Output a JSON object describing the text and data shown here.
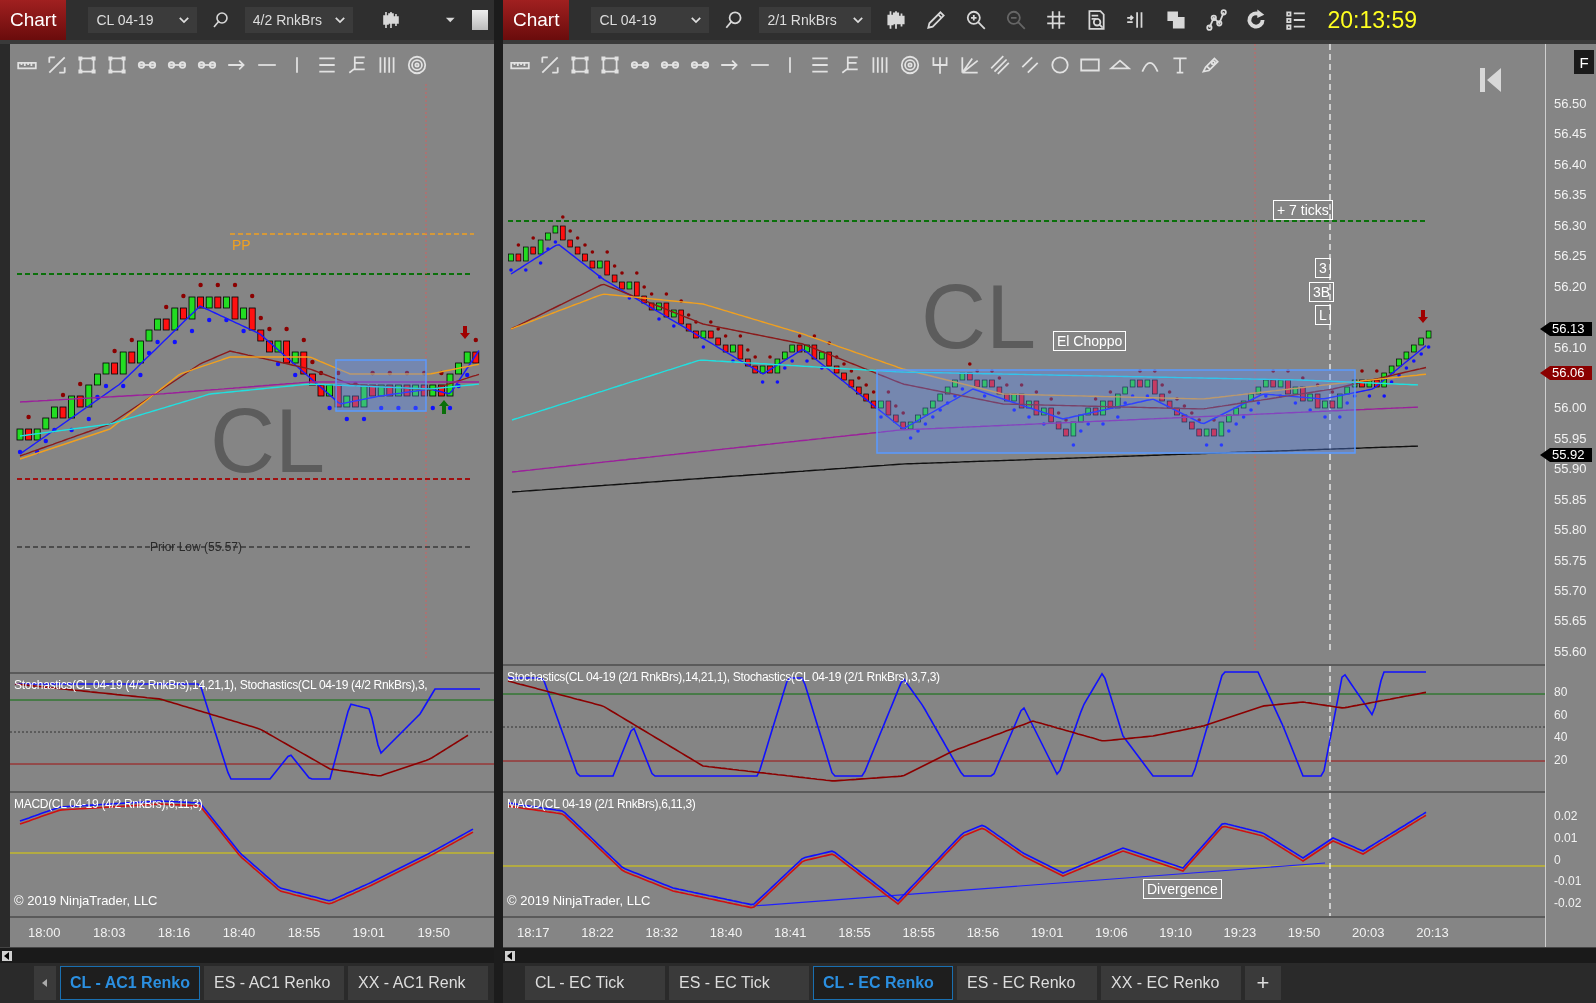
{
  "left": {
    "chart_button": "Chart",
    "instrument": "CL 04-19",
    "bar_type": "4/2 RnkBrs",
    "watermark": "CL",
    "pp_label": "PP",
    "prior_low_label": "Prior Low (55.57)",
    "stochastics_title": "Stochastics(CL 04-19 (4/2 RnkBrs),14,21,1), Stochastics(CL 04-19 (4/2 RnkBrs),3,",
    "macd_title": "MACD(CL 04-19 (4/2 RnkBrs),6,11,3)",
    "copyright": "© 2019 NinjaTrader, LLC",
    "time_labels": [
      "18:00",
      "18:03",
      "18:16",
      "18:40",
      "18:55",
      "19:01",
      "19:50"
    ],
    "tabs": [
      {
        "label": "CL - AC1 Renko",
        "selected": true
      },
      {
        "label": "ES - AC1 Renko",
        "selected": false
      },
      {
        "label": "XX - AC1 Renk",
        "selected": false
      }
    ]
  },
  "right": {
    "chart_button": "Chart",
    "instrument": "CL 04-19",
    "bar_type": "2/1 RnkBrs",
    "clock": "20:13:59",
    "watermark": "CL",
    "side_button": "F",
    "annotations": [
      {
        "kind": "box",
        "text": "El Choppo"
      },
      {
        "kind": "box",
        "text": "+ 7 ticks"
      },
      {
        "kind": "box",
        "text": "3"
      },
      {
        "kind": "box",
        "text": "3B"
      },
      {
        "kind": "box",
        "text": "L"
      }
    ],
    "price_labels": [
      "56.50",
      "56.45",
      "56.40",
      "56.35",
      "56.30",
      "56.25",
      "56.20",
      "56.10",
      "56.00",
      "55.95",
      "55.90",
      "55.85",
      "55.80",
      "55.75",
      "55.70",
      "55.65",
      "55.60"
    ],
    "price_markers": [
      {
        "label": "56.13",
        "color": "#000000"
      },
      {
        "label": "56.06",
        "color": "#8b0000"
      },
      {
        "label": "55.92",
        "color": "#000000"
      }
    ],
    "stochastics_title": "Stochastics(CL 04-19 (2/1 RnkBrs),14,21,1), Stochastics(CL 04-19 (2/1 RnkBrs),3,7,3)",
    "stochastics_axis": [
      "80",
      "60",
      "40",
      "20"
    ],
    "macd_title": "MACD(CL 04-19 (2/1 RnkBrs),6,11,3)",
    "macd_axis": [
      "0.02",
      "0.01",
      "0",
      "-0.01",
      "-0.02"
    ],
    "divergence_label": "Divergence",
    "copyright": "© 2019 NinjaTrader, LLC",
    "time_labels": [
      "18:17",
      "18:22",
      "18:32",
      "18:40",
      "18:41",
      "18:55",
      "18:55",
      "18:56",
      "19:01",
      "19:06",
      "19:10",
      "19:23",
      "19:50",
      "20:03",
      "20:13"
    ],
    "tabs": [
      {
        "label": "CL - EC Tick",
        "selected": false
      },
      {
        "label": "ES - EC Tick",
        "selected": false
      },
      {
        "label": "CL - EC Renko",
        "selected": true
      },
      {
        "label": "ES - EC Renko",
        "selected": false
      },
      {
        "label": "XX - EC Renko",
        "selected": false
      }
    ],
    "add_tab": "+"
  }
}
